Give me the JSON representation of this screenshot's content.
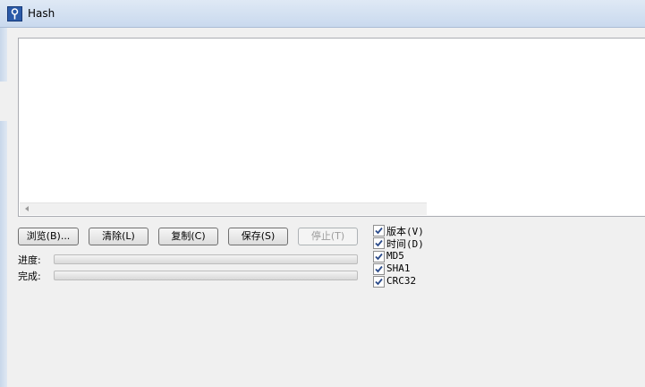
{
  "window": {
    "title": "Hash"
  },
  "buttons": {
    "browse": "浏览(B)...",
    "clear": "清除(L)",
    "copy": "复制(C)",
    "save": "保存(S)",
    "stop": "停止(T)"
  },
  "progress": {
    "progress_label": "进度:",
    "complete_label": "完成:",
    "progress_value": 0,
    "complete_value": 0
  },
  "options": [
    {
      "label": "版本(V)",
      "checked": true
    },
    {
      "label": "时间(D)",
      "checked": true
    },
    {
      "label": "MD5",
      "checked": true
    },
    {
      "label": "SHA1",
      "checked": true
    },
    {
      "label": "CRC32",
      "checked": true
    }
  ],
  "colors": {
    "progress_fill": "#06b025",
    "title_bar": "#dfe9f5"
  }
}
